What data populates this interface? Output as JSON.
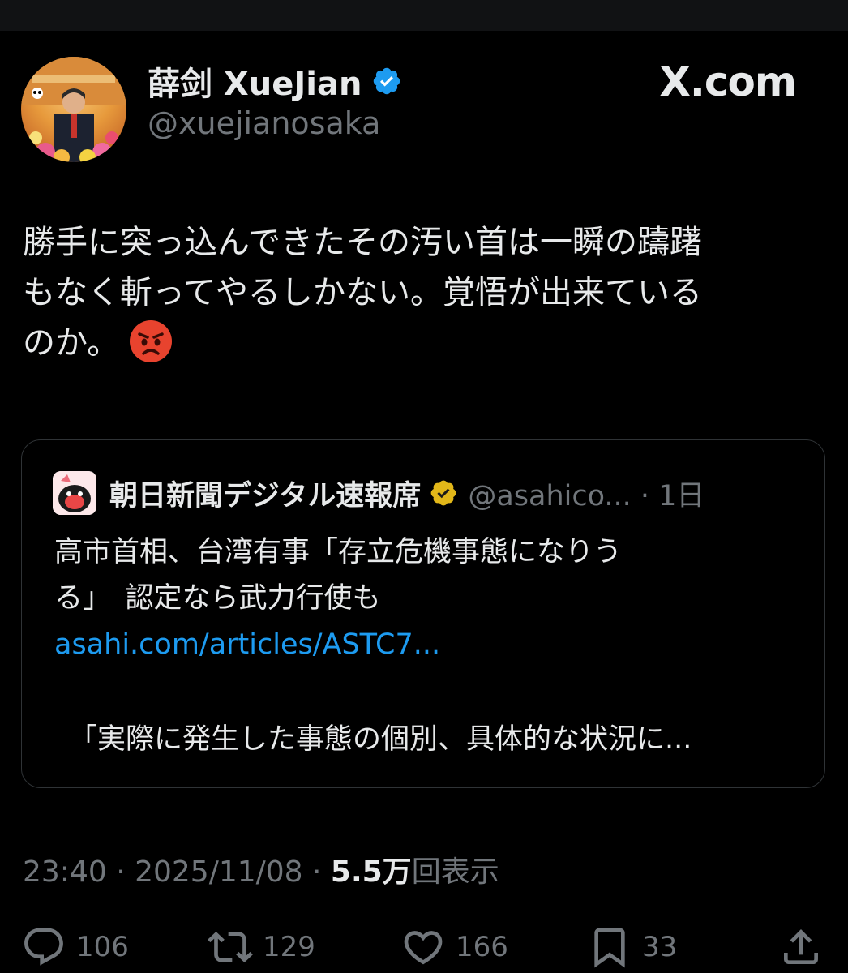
{
  "author": {
    "display_name": "薛剑 XueJian",
    "handle": "@xuejianosaka"
  },
  "site_label": "X.com",
  "tweet": {
    "line1": "勝手に突っ込んできたその汚い首は一瞬の躊躇",
    "line2": "もなく斬ってやるしかない。覚悟が出来ている",
    "line3": "のか。"
  },
  "quoted": {
    "name": "朝日新聞デジタル速報席",
    "handle_time": "@asahico... · 1日",
    "text_line1": "高市首相、台湾有事「存立危機事態になりう",
    "text_line2": "る」　認定なら武力行使も",
    "link": "asahi.com/articles/ASTC7...",
    "excerpt": "「実際に発生した事態の個別、具体的な状況に..."
  },
  "meta": {
    "time_date": "23:40 · 2025/11/08 · ",
    "views_count": "5.5万",
    "views_label": "回表示"
  },
  "actions": {
    "replies": "106",
    "reposts": "129",
    "likes": "166",
    "bookmarks": "33"
  },
  "colors": {
    "background": "#000000",
    "text": "#e7e9ea",
    "muted": "#71767b",
    "link": "#1d9bf0",
    "verified_blue": "#1d9bf0",
    "verified_gold": "#e2b719",
    "emoji_red": "#e8432e"
  }
}
